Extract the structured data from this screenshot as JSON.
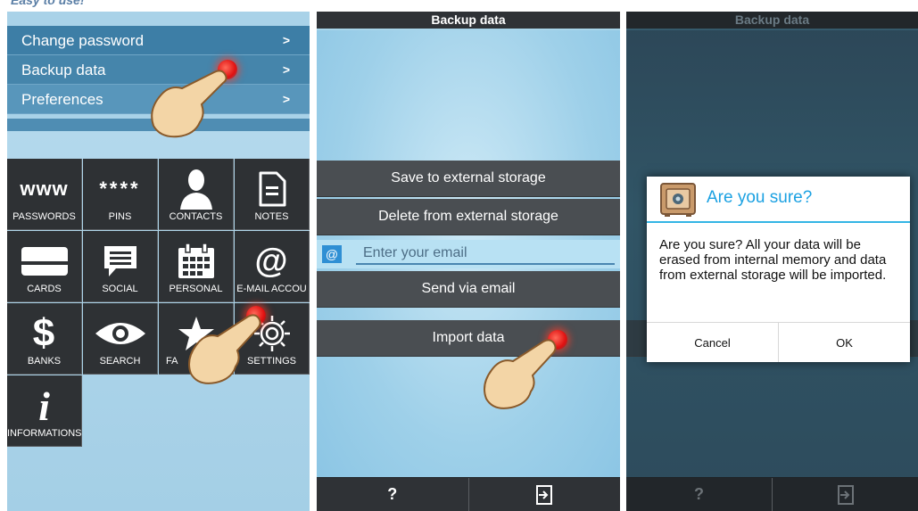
{
  "tagline": "Easy to use!",
  "settings_screen": {
    "menu": [
      {
        "label": "Change password",
        "chevron": ">"
      },
      {
        "label": "Backup data",
        "chevron": ">"
      },
      {
        "label": "Preferences",
        "chevron": ">"
      }
    ],
    "tiles": [
      {
        "label": "PASSWORDS",
        "icon_text": "www",
        "icon": "www-text-icon"
      },
      {
        "label": "PINS",
        "icon_text": "****",
        "icon": "asterisks-icon"
      },
      {
        "label": "CONTACTS",
        "icon": "person-icon"
      },
      {
        "label": "NOTES",
        "icon": "document-icon"
      },
      {
        "label": "CARDS",
        "icon": "card-icon"
      },
      {
        "label": "SOCIAL",
        "icon": "speech-bubble-icon"
      },
      {
        "label": "PERSONAL",
        "icon": "calendar-icon"
      },
      {
        "label": "E-MAIL ACCOU",
        "icon_text": "@",
        "icon": "at-sign-icon"
      },
      {
        "label": "BANKS",
        "icon_text": "$",
        "icon": "dollar-icon"
      },
      {
        "label": "SEARCH",
        "icon": "eye-icon"
      },
      {
        "label": "FA",
        "icon": "star-icon"
      },
      {
        "label": "SETTINGS",
        "icon": "gear-icon"
      },
      {
        "label": "INFORMATIONS",
        "icon_text": "i",
        "icon": "info-icon"
      }
    ]
  },
  "backup_screen": {
    "title": "Backup data",
    "buttons": {
      "save_external": "Save to external storage",
      "delete_external": "Delete from external storage",
      "send_email": "Send via email",
      "import": "Import data"
    },
    "email": {
      "at_icon": "@",
      "placeholder": "Enter your email"
    },
    "bottom_bar": {
      "help": "?",
      "exit_icon": "exit-door-icon"
    }
  },
  "confirm_screen": {
    "title": "Backup data",
    "dialog": {
      "title": "Are you sure?",
      "message": "Are you sure? All your data will be erased from internal memory and data from external storage will be imported.",
      "cancel": "Cancel",
      "ok": "OK",
      "icon": "safe-icon"
    },
    "bottom_bar": {
      "help": "?",
      "exit_icon": "exit-door-icon"
    }
  },
  "colors": {
    "accent": "#33b5e5",
    "header": "#2f3236",
    "menu": "#4a8ab0",
    "touch_dot": "#e01010"
  }
}
